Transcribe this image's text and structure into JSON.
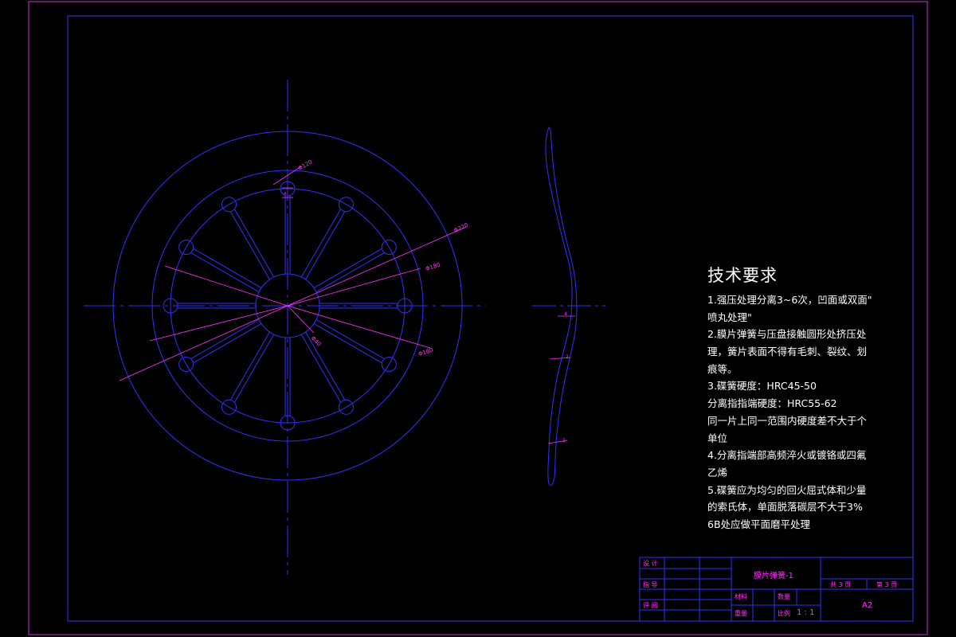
{
  "drawing": {
    "dimension_labels": {
      "d_inner_ring": "Φ120",
      "d_outer": "Φ220",
      "d_mid": "Φ180",
      "d_bore": "Φ40",
      "d_finger_tip": "Φ160"
    },
    "thickness_labels": [
      "4",
      "2",
      "2"
    ]
  },
  "tech_requirements": {
    "title": "技术要求",
    "lines": [
      "1.强压处理分离3~6次，凹面或双面\"",
      "喷丸处理\"",
      "2.膜片弹簧与压盘接触圆形处挤压处",
      "理，簧片表面不得有毛刺、裂纹、划",
      "痕等。",
      "3.碟簧硬度：HRC45-50",
      "分离指指端硬度：HRC55-62",
      "同一片上同一范围内硬度差不大于个",
      "单位",
      "4.分离指端部高频淬火或镀铬或四氟",
      "乙烯",
      "5.碟簧应为均匀的回火屈式体和少量",
      "的索氏体，单面脱落碳层不大于3%",
      "6B处应做平面磨平处理"
    ]
  },
  "title_block": {
    "design_label": "设 计",
    "drawing_label": "指 导",
    "review_label": "评 阅",
    "part_name": "膜片弹簧-1",
    "total_pages": "共 3 页",
    "page_no": "第 3 页",
    "material_label": "材料",
    "quantity_label": "数量",
    "weight_label": "重量",
    "scale_label": "比例",
    "scale_value": "1 : 1",
    "sheet_size": "A2"
  }
}
